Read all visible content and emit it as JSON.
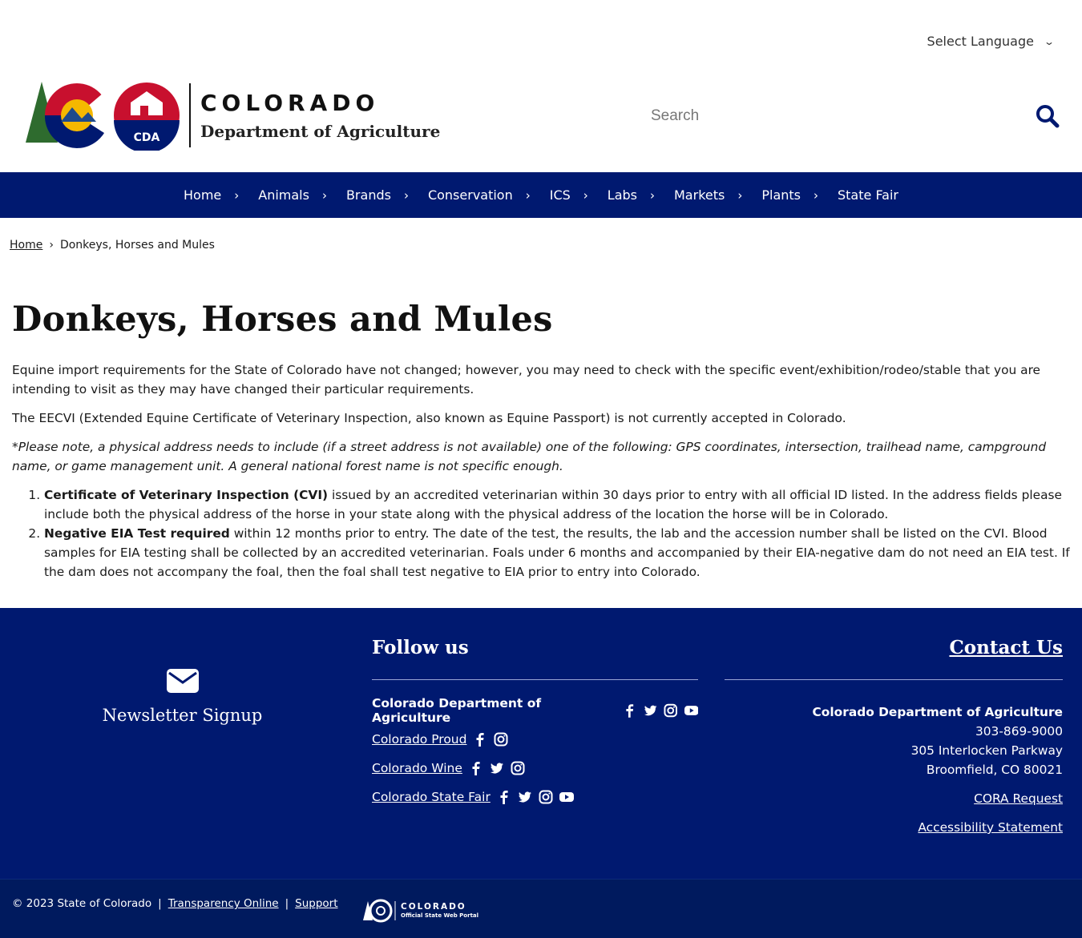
{
  "header": {
    "language_label": "Select Language",
    "logo_line1": "COLORADO",
    "logo_line2": "Department of Agriculture",
    "logo_badge": "CDA",
    "search_placeholder": "Search"
  },
  "nav": {
    "items": [
      {
        "label": "Home"
      },
      {
        "label": "Animals"
      },
      {
        "label": "Brands"
      },
      {
        "label": "Conservation"
      },
      {
        "label": "ICS"
      },
      {
        "label": "Labs"
      },
      {
        "label": "Markets"
      },
      {
        "label": "Plants"
      },
      {
        "label": "State Fair"
      }
    ]
  },
  "breadcrumb": {
    "home": "Home",
    "separator": "›",
    "current": "Donkeys, Horses and Mules"
  },
  "main": {
    "title": "Donkeys, Horses and Mules",
    "para1": "Equine import requirements for the State of Colorado have not changed; however, you may need to check with the specific event/exhibition/rodeo/stable that you are intending to visit as they may have changed their particular requirements.",
    "para2": "The EECVI (Extended Equine Certificate of Veterinary Inspection, also known as Equine Passport) is not currently accepted in Colorado.",
    "note": "*Please note, a physical address needs to include (if a street address is not available) one of the following: GPS coordinates, intersection, trailhead name, campground name, or game management unit.  A general national forest name is not specific enough.",
    "requirements": [
      {
        "bold": "Certificate of Veterinary Inspection (CVI)",
        "text": " issued by an accredited veterinarian within 30 days prior to entry with all official ID listed. In the address fields please include both the physical address of the horse in your state along with the physical address of the location the horse will be in Colorado."
      },
      {
        "bold": "Negative EIA Test required",
        "text": " within 12 months prior to entry. The date of the test, the results, the lab and the accession number shall be listed on the CVI. Blood samples for EIA testing shall be collected by an accredited veterinarian. Foals under 6 months and accompanied by their EIA-negative dam do not need an EIA test. If the dam does not accompany the foal, then the foal shall test negative to EIA prior to entry into Colorado."
      }
    ]
  },
  "footer": {
    "newsletter": "Newsletter Signup",
    "follow_title": "Follow us",
    "social": [
      {
        "label": "Colorado Department of Agriculture",
        "icons": [
          "facebook-icon",
          "twitter-icon",
          "instagram-icon",
          "youtube-icon"
        ]
      },
      {
        "label": "Colorado Proud",
        "icons": [
          "facebook-icon",
          "instagram-icon"
        ]
      },
      {
        "label": "Colorado Wine",
        "icons": [
          "facebook-icon",
          "twitter-icon",
          "instagram-icon"
        ]
      },
      {
        "label": "Colorado State Fair",
        "icons": [
          "facebook-icon",
          "twitter-icon",
          "instagram-icon",
          "youtube-icon"
        ]
      }
    ],
    "contact_title": "Contact Us",
    "contact_org": "Colorado Department of Agriculture",
    "contact_phone": "303-869-9000",
    "contact_addr1": "305 Interlocken Parkway",
    "contact_addr2": "Broomfield, CO 80021",
    "cora": "CORA Request",
    "accessibility": "Accessibility Statement"
  },
  "bottom": {
    "copyright": "© 2023 State of Colorado",
    "sep": "|",
    "transparency": "Transparency Online",
    "support": "Support",
    "portal_line1": "COLORADO",
    "portal_line2": "Official State Web Portal"
  },
  "colors": {
    "brand_navy": "#001970",
    "brand_red": "#c8102e",
    "brand_gold": "#f5b800"
  }
}
